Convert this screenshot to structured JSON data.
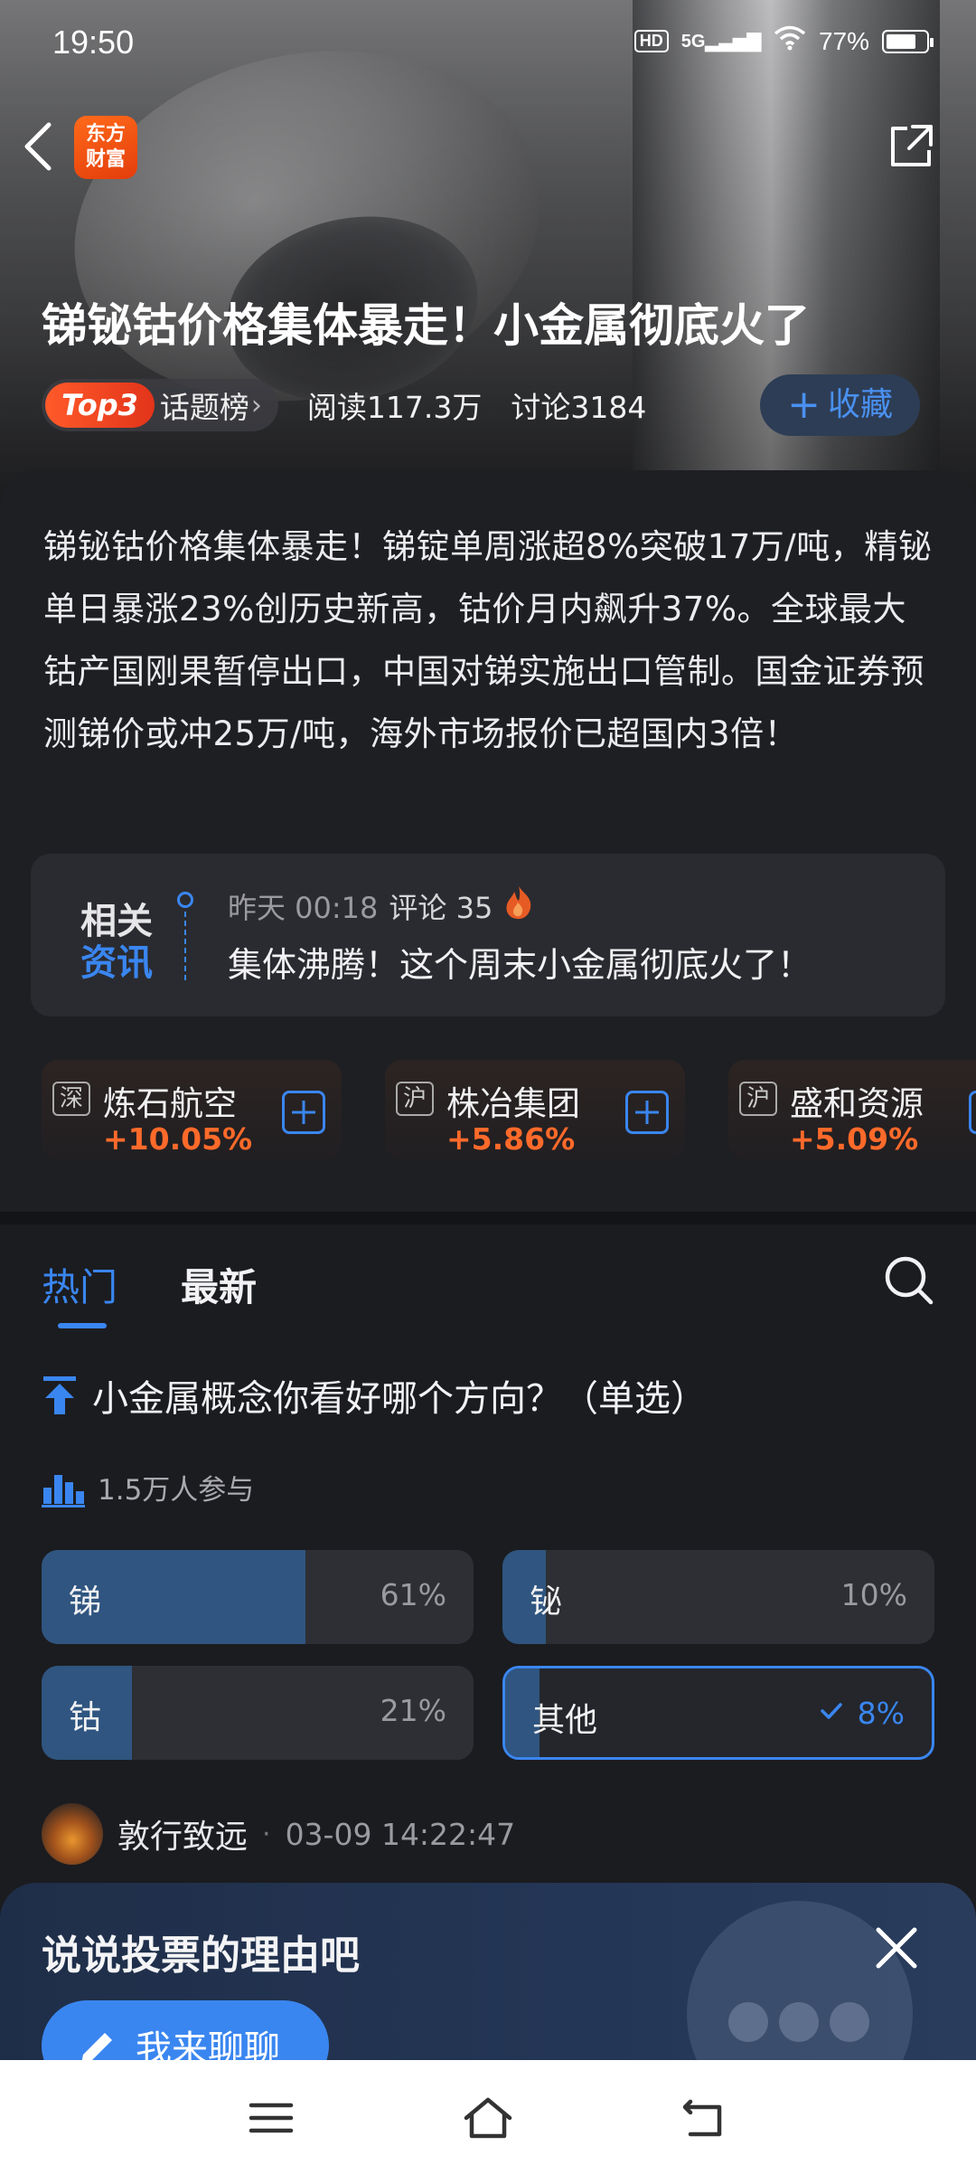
{
  "status_bar": {
    "time": "19:50",
    "hd": "HD",
    "network": "5G",
    "battery": "77%"
  },
  "header": {
    "logo_line1": "东方",
    "logo_line2": "财富"
  },
  "topic": {
    "title": "锑铋钴价格集体暴走！小金属彻底火了",
    "rank_badge": "Top3",
    "rank_label": "话题榜",
    "reads": "阅读117.3万",
    "discussions": "讨论3184",
    "favorite_label": "收藏"
  },
  "intro_text": "锑铋钴价格集体暴走！锑锭单周涨超8%突破17万/吨，精铋单日暴涨23%创历史新高，钴价月内飙升37%。全球最大钴产国刚果暂停出口，中国对锑实施出口管制。国金证券预测锑价或冲25万/吨，海外市场报价已超国内3倍！",
  "related_news": {
    "tag_line1": "相关",
    "tag_line2": "资讯",
    "time": "昨天 00:18",
    "comments": "评论 35",
    "headline": "集体沸腾！这个周末小金属彻底火了！"
  },
  "stocks": [
    {
      "exchange": "深",
      "name": "炼石航空",
      "change": "+10.05%"
    },
    {
      "exchange": "沪",
      "name": "株冶集团",
      "change": "+5.86%"
    },
    {
      "exchange": "沪",
      "name": "盛和资源",
      "change": "+5.09%"
    }
  ],
  "tabs": {
    "hot": "热门",
    "latest": "最新"
  },
  "poll": {
    "question": "小金属概念你看好哪个方向？（单选）",
    "participants": "1.5万人参与",
    "options": [
      {
        "label": "锑",
        "percent": "61%",
        "share": 0.61
      },
      {
        "label": "铋",
        "percent": "10%",
        "share": 0.1
      },
      {
        "label": "钴",
        "percent": "21%",
        "share": 0.21
      },
      {
        "label": "其他",
        "percent": "8%",
        "share": 0.08,
        "selected": true
      }
    ]
  },
  "comment": {
    "author": "敦行致远",
    "separator": "·",
    "time": "03-09 14:22:47"
  },
  "prompt": {
    "title": "说说投票的理由吧",
    "button": "我来聊聊"
  },
  "colors": {
    "accent": "#3a86f0",
    "up": "#ff6a2a",
    "background": "#1b1c20"
  }
}
